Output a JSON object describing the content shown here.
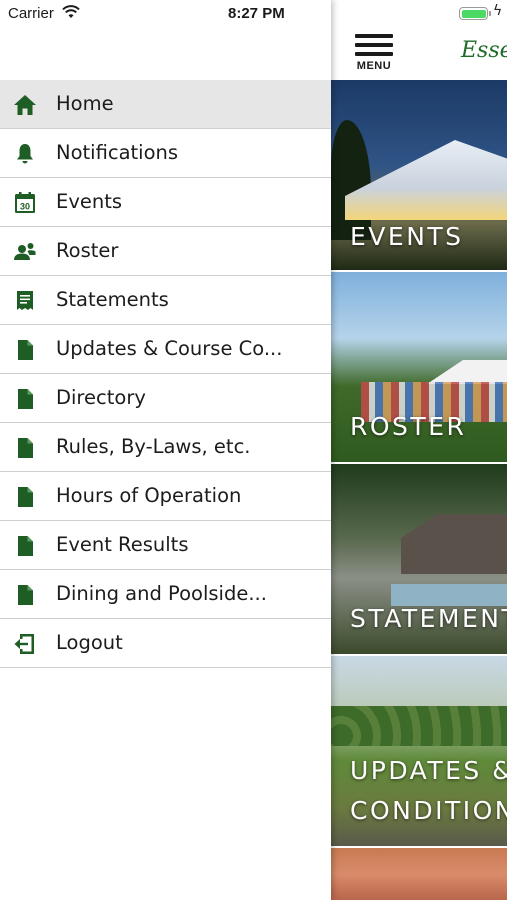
{
  "status_bar": {
    "carrier": "Carrier",
    "time": "8:27 PM"
  },
  "app": {
    "menu_label": "MENU",
    "logo_text": "Essex",
    "tiles": [
      {
        "caption": "EVENTS"
      },
      {
        "caption": "ROSTER"
      },
      {
        "caption": "STATEMENTS"
      },
      {
        "caption_line1": "UPDATES &",
        "caption_line2": "CONDITIONS"
      },
      {
        "caption": ""
      }
    ]
  },
  "drawer": {
    "active_index": 0,
    "items": [
      {
        "label": "Home",
        "icon": "home-icon"
      },
      {
        "label": "Notifications",
        "icon": "bell-icon"
      },
      {
        "label": "Events",
        "icon": "calendar-icon"
      },
      {
        "label": "Roster",
        "icon": "people-icon"
      },
      {
        "label": "Statements",
        "icon": "receipt-icon"
      },
      {
        "label": "Updates & Course Co...",
        "icon": "document-icon"
      },
      {
        "label": "Directory",
        "icon": "document-icon"
      },
      {
        "label": "Rules, By-Laws, etc.",
        "icon": "document-icon"
      },
      {
        "label": "Hours of Operation",
        "icon": "document-icon"
      },
      {
        "label": "Event Results",
        "icon": "document-icon"
      },
      {
        "label": "Dining and Poolside...",
        "icon": "document-icon"
      },
      {
        "label": "Logout",
        "icon": "logout-icon"
      }
    ]
  },
  "colors": {
    "icon_green": "#1e5e25",
    "active_row": "#e6e6e6",
    "divider": "#cfcfcf",
    "battery": "#4cd964"
  }
}
